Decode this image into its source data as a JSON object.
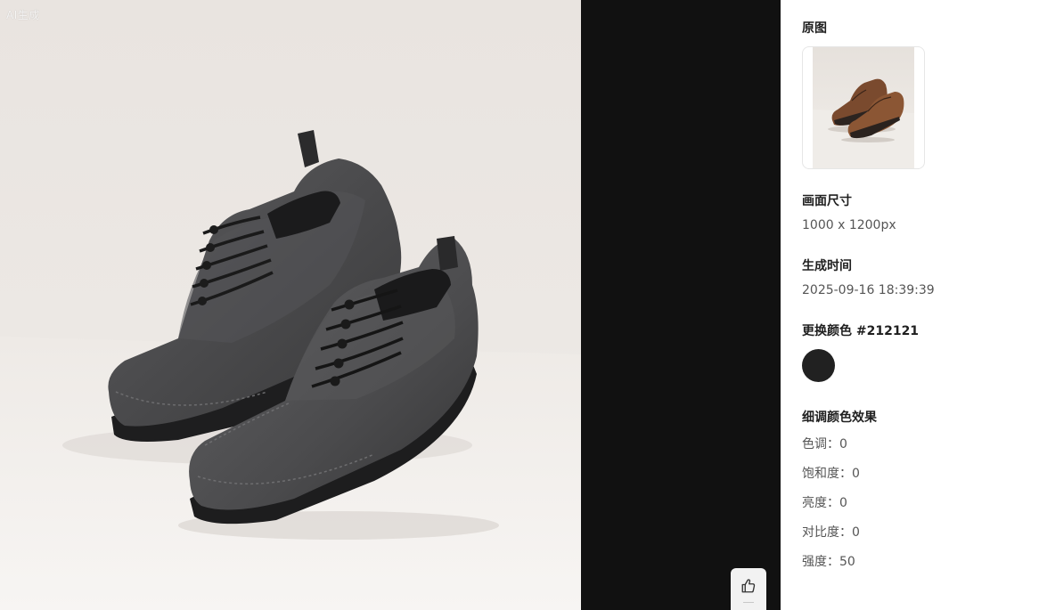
{
  "preview": {
    "badge": "AI生成",
    "like_icon": "thumbs-up-icon",
    "background_color": "#111111"
  },
  "panel": {
    "original": {
      "title": "原图"
    },
    "canvas_size": {
      "title": "画面尺寸",
      "value": "1000 x 1200px"
    },
    "generated_time": {
      "title": "生成时间",
      "value": "2025-09-16 18:39:39"
    },
    "replace_color": {
      "title": "更换颜色",
      "hex": "#212121"
    },
    "fine_tune": {
      "title": "细调颜色效果",
      "rows": [
        {
          "label": "色调",
          "value": "0"
        },
        {
          "label": "饱和度",
          "value": "0"
        },
        {
          "label": "亮度",
          "value": "0"
        },
        {
          "label": "对比度",
          "value": "0"
        },
        {
          "label": "强度",
          "value": "50"
        }
      ]
    }
  }
}
